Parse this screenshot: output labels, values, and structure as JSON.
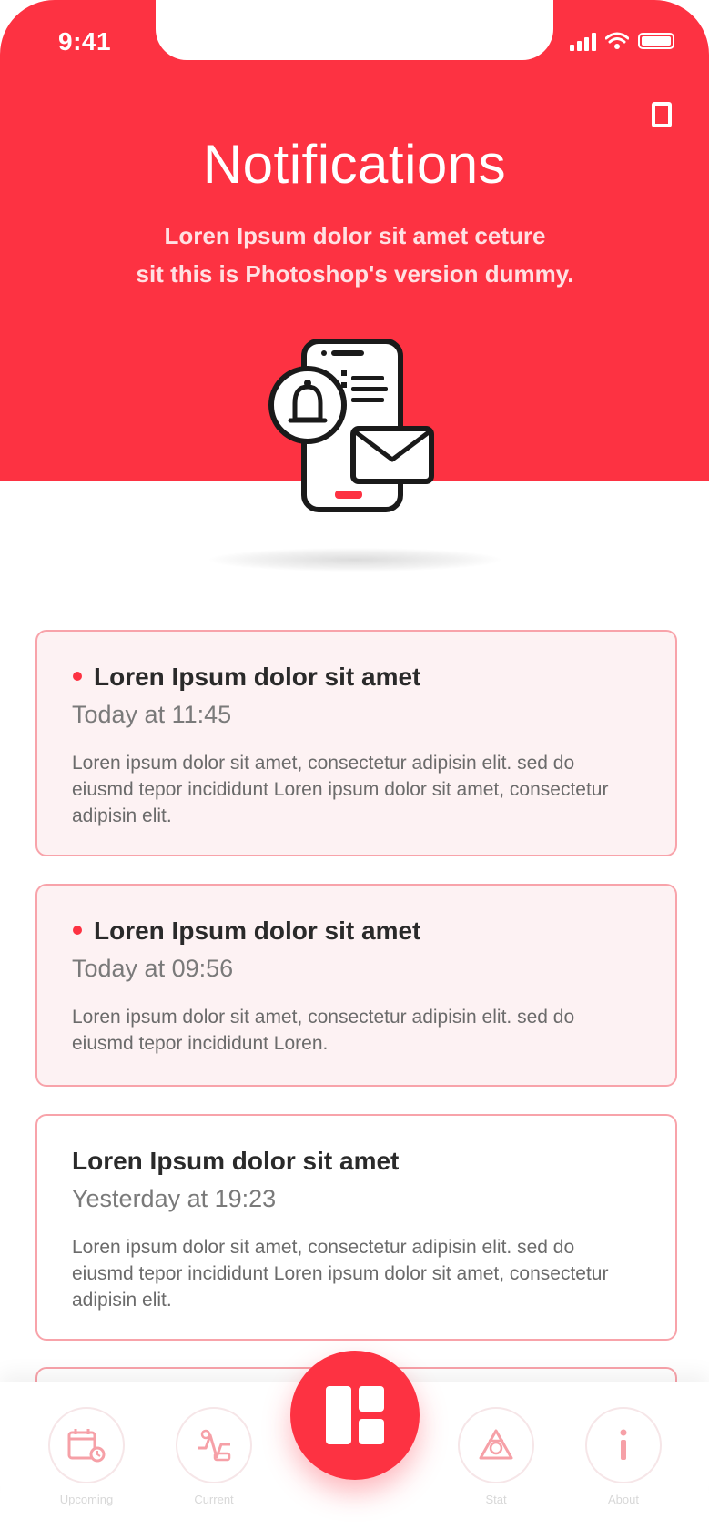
{
  "status_bar": {
    "time": "9:41"
  },
  "header": {
    "title": "Notifications",
    "subtitle_line1": "Loren Ipsum dolor sit amet ceture",
    "subtitle_line2": "sit  this is Photoshop's version dummy."
  },
  "notifications": [
    {
      "title": "Loren Ipsum dolor sit amet",
      "time": "Today at 11:45",
      "body": "Loren ipsum dolor sit amet, consectetur adipisin elit. sed do eiusmd tepor incididunt Loren ipsum dolor sit amet, consectetur adipisin elit.",
      "unread": true
    },
    {
      "title": "Loren Ipsum dolor sit amet",
      "time": "Today at 09:56",
      "body": "Loren ipsum dolor sit amet, consectetur adipisin elit. sed do eiusmd tepor incididunt Loren.",
      "unread": true
    },
    {
      "title": "Loren Ipsum dolor sit amet",
      "time": "Yesterday at 19:23",
      "body": "Loren ipsum dolor sit amet, consectetur adipisin elit. sed do eiusmd tepor incididunt Loren ipsum dolor sit amet, consectetur adipisin elit.",
      "unread": false
    }
  ],
  "bottom_nav": {
    "items": [
      {
        "label": "Upcoming",
        "icon": "calendar-icon"
      },
      {
        "label": "Current",
        "icon": "activity-icon"
      },
      {
        "label": "Stat",
        "icon": "chart-icon"
      },
      {
        "label": "About",
        "icon": "info-icon"
      }
    ],
    "center_icon": "dashboard-grid-icon"
  },
  "colors": {
    "accent": "#fd3242",
    "card_border": "#f8a3aa",
    "unread_bg": "#fdf2f3"
  }
}
